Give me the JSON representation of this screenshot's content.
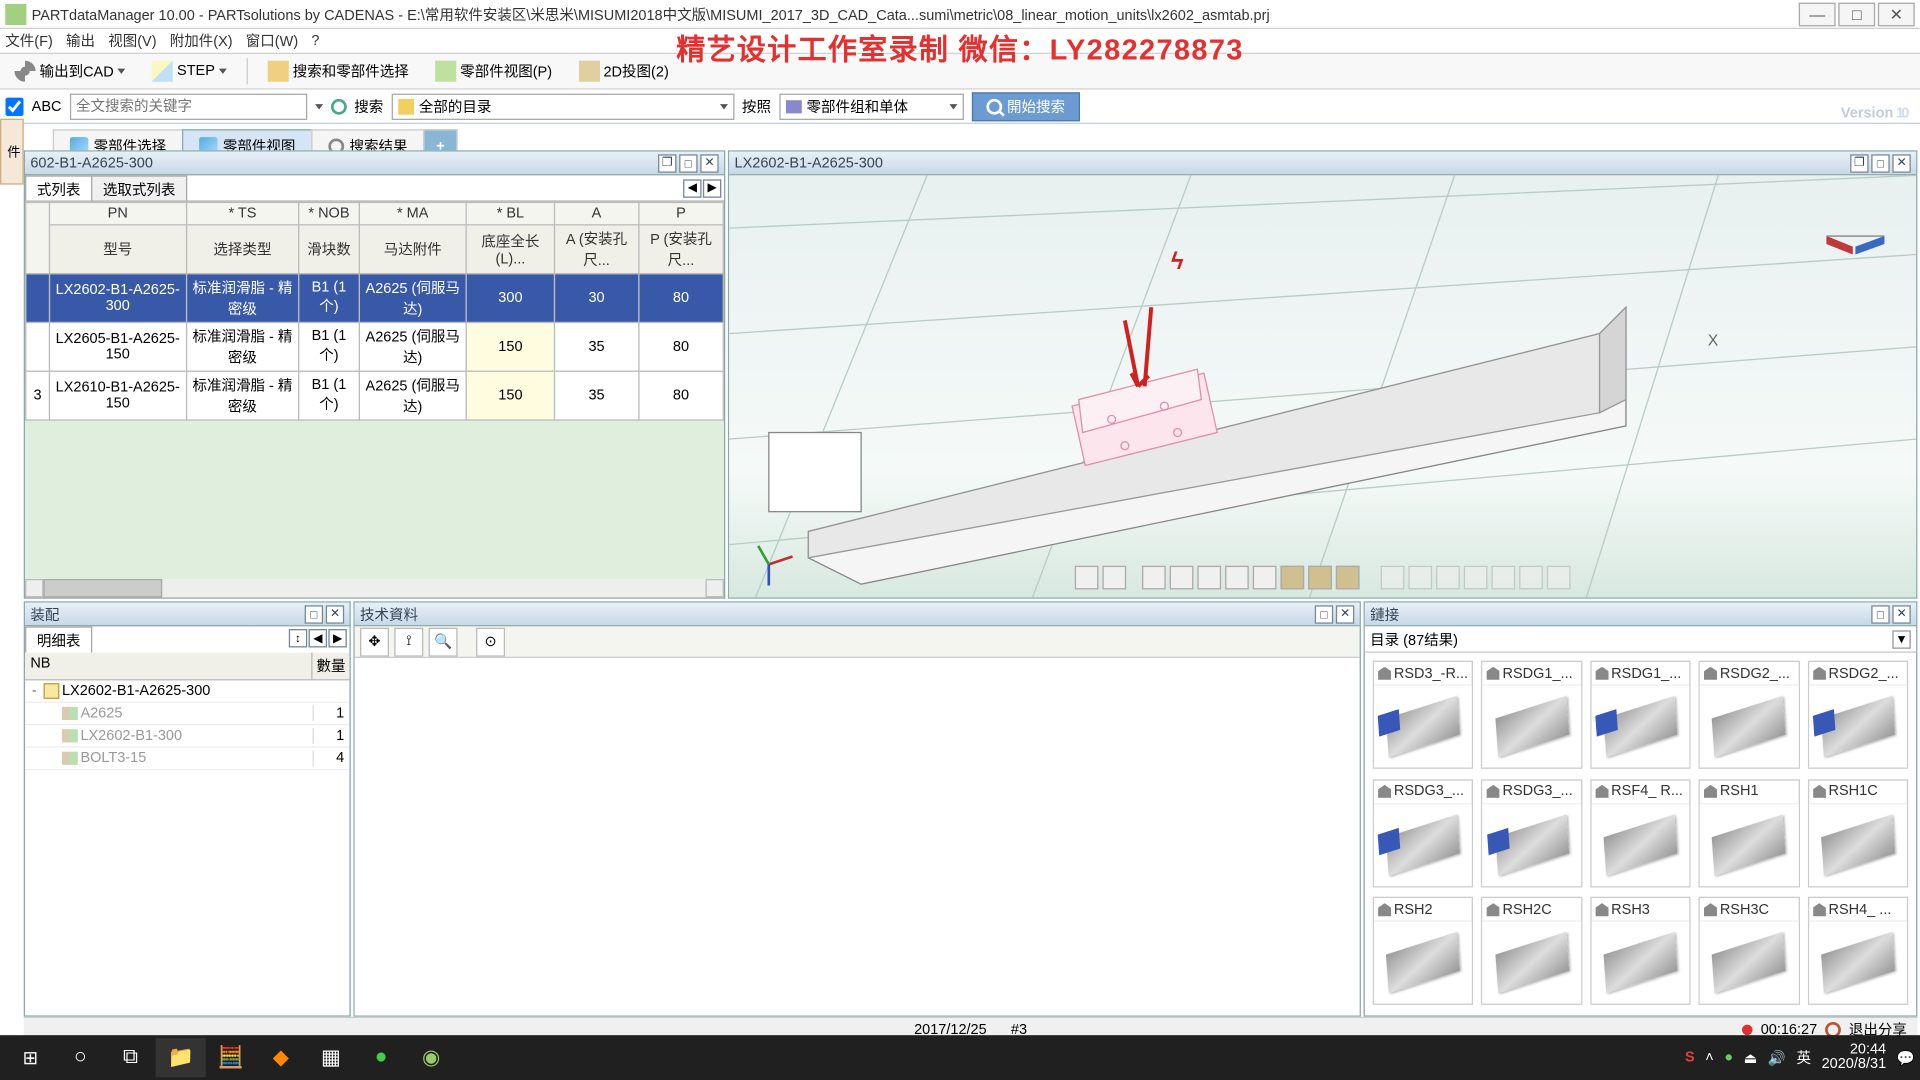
{
  "window": {
    "title": "PARTdataManager 10.00 - PARTsolutions by CADENAS - E:\\常用软件安装区\\米思米\\MISUMI2018中文版\\MISUMI_2017_3D_CAD_Cata...sumi\\metric\\08_linear_motion_units\\lx2602_asmtab.prj",
    "min": "—",
    "max": "□",
    "close": "✕"
  },
  "menu": {
    "file": "文件(F)",
    "output": "输出",
    "view": "视图(V)",
    "addin": "附加件(X)",
    "window": "窗口(W)",
    "help": "?"
  },
  "toolbar": {
    "export": "输出到CAD",
    "step": "STEP",
    "searchSelect": "搜索和零部件选择",
    "partView": "零部件视图(P)",
    "proj2d": "2D投图(2)"
  },
  "search": {
    "abc": "ABC",
    "kwPlaceholder": "全文搜索的关键字",
    "searchLabel": "搜索",
    "allDirs": "全部的目录",
    "byLabel": "按照",
    "byValue": "零部件组和单体",
    "start": "開始捜索"
  },
  "tabs": {
    "partSelect": "零部件选择",
    "partView": "零部件视图",
    "results": "搜索结果",
    "add": "+"
  },
  "leftPanel": {
    "title": "602-B1-A2625-300",
    "sub1": "式列表",
    "sub2": "选取式列表",
    "cols": {
      "rn": "",
      "pn": "PN",
      "pn2": "型号",
      "ts": "* TS",
      "ts2": "选择类型",
      "nob": "* NOB",
      "nob2": "滑块数",
      "ma": "* MA",
      "ma2": "马达附件",
      "bl": "* BL",
      "bl2": "底座全长 (L)...",
      "a": "A",
      "a2": "A (安装孔尺...",
      "p": "P",
      "p2": "P (安装孔尺..."
    },
    "rows": [
      {
        "rn": "",
        "pn": "LX2602-B1-A2625-300",
        "ts": "标准润滑脂 - 精密级",
        "nob": "B1 (1个)",
        "ma": "A2625 (伺服马达)",
        "bl": "300",
        "a": "30",
        "p": "80",
        "sel": true
      },
      {
        "rn": "",
        "pn": "LX2605-B1-A2625-150",
        "ts": "标准润滑脂 - 精密级",
        "nob": "B1 (1个)",
        "ma": "A2625 (伺服马达)",
        "bl": "150",
        "a": "35",
        "p": "80"
      },
      {
        "rn": "3",
        "pn": "LX2610-B1-A2625-150",
        "ts": "标准润滑脂 - 精密级",
        "nob": "B1 (1个)",
        "ma": "A2625 (伺服马达)",
        "bl": "150",
        "a": "35",
        "p": "80"
      }
    ]
  },
  "viewPanel": {
    "title": "LX2602-B1-A2625-300",
    "xAxis": "X"
  },
  "asm": {
    "title": "装配",
    "tab": "明细表",
    "hNB": "NB",
    "hQty": "數量",
    "nodes": [
      {
        "lvl": 0,
        "exp": "-",
        "name": "LX2602-B1-A2625-300",
        "qty": "",
        "folder": true
      },
      {
        "lvl": 1,
        "exp": "",
        "name": "A2625",
        "qty": "1",
        "gray": true
      },
      {
        "lvl": 1,
        "exp": "",
        "name": "LX2602-B1-300",
        "qty": "1",
        "gray": true
      },
      {
        "lvl": 1,
        "exp": "",
        "name": "BOLT3-15",
        "qty": "4",
        "gray": true
      }
    ]
  },
  "tech": {
    "title": "技术資料"
  },
  "links": {
    "title": "鏈接",
    "catalog": "目录 (87结果)",
    "items": [
      {
        "n": "RSD3_-R...",
        "blue": true
      },
      {
        "n": "RSDG1_...",
        "blue": false
      },
      {
        "n": "RSDG1_...",
        "blue": true
      },
      {
        "n": "RSDG2_...",
        "blue": false
      },
      {
        "n": "RSDG2_...",
        "blue": true
      },
      {
        "n": "RSDG3_...",
        "blue": true
      },
      {
        "n": "RSDG3_...",
        "blue": true
      },
      {
        "n": "RSF4_ R...",
        "blue": false
      },
      {
        "n": "RSH1",
        "blue": false
      },
      {
        "n": "RSH1C",
        "blue": false
      },
      {
        "n": "RSH2",
        "blue": false
      },
      {
        "n": "RSH2C",
        "blue": false
      },
      {
        "n": "RSH3",
        "blue": false
      },
      {
        "n": "RSH3C",
        "blue": false
      },
      {
        "n": "RSH4_ ...",
        "blue": false
      }
    ]
  },
  "status": {
    "date": "2017/12/25",
    "num": "#3",
    "timer": "00:16:27",
    "exit": "退出分享"
  },
  "watermark": "精艺设计工作室录制 微信：LY282278873",
  "brand": {
    "v": "Version",
    "n": "10"
  },
  "side": {
    "a": "件"
  },
  "taskbar": {
    "time": "20:44",
    "date": "2020/8/31"
  }
}
